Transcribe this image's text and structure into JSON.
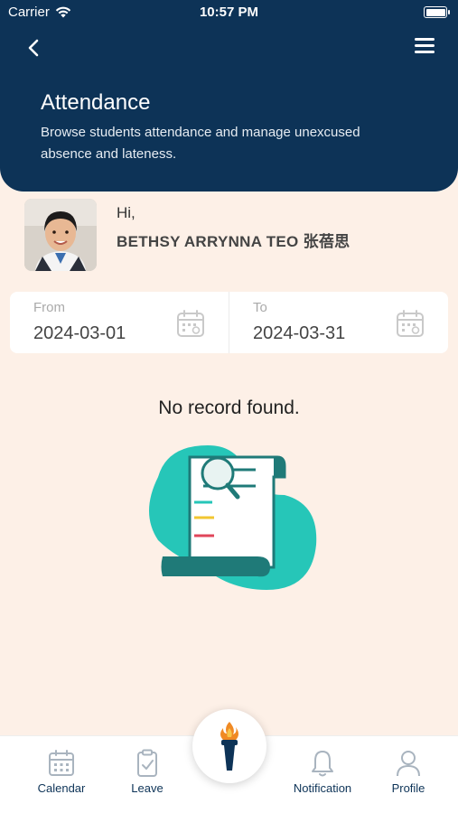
{
  "status_bar": {
    "carrier": "Carrier",
    "time": "10:57 PM"
  },
  "header": {
    "title": "Attendance",
    "subtitle": "Browse students attendance and manage unexcused absence and lateness."
  },
  "student": {
    "greeting": "Hi,",
    "name": "BETHSY ARRYNNA TEO 张蓓思"
  },
  "date_range": {
    "from_label": "From",
    "from_value": "2024-03-01",
    "to_label": "To",
    "to_value": "2024-03-31"
  },
  "empty_message": "No record found.",
  "nav": {
    "items": [
      {
        "label": "Calendar",
        "icon": "calendar-icon"
      },
      {
        "label": "Leave",
        "icon": "clipboard-check-icon"
      },
      {
        "label": "Notification",
        "icon": "bell-icon"
      },
      {
        "label": "Profile",
        "icon": "person-icon"
      }
    ],
    "center_icon": "torch-icon"
  },
  "colors": {
    "header": "#0d3357",
    "background": "#fdf0e7",
    "teal": "#26c6b8",
    "dark_teal": "#1f7a78"
  }
}
